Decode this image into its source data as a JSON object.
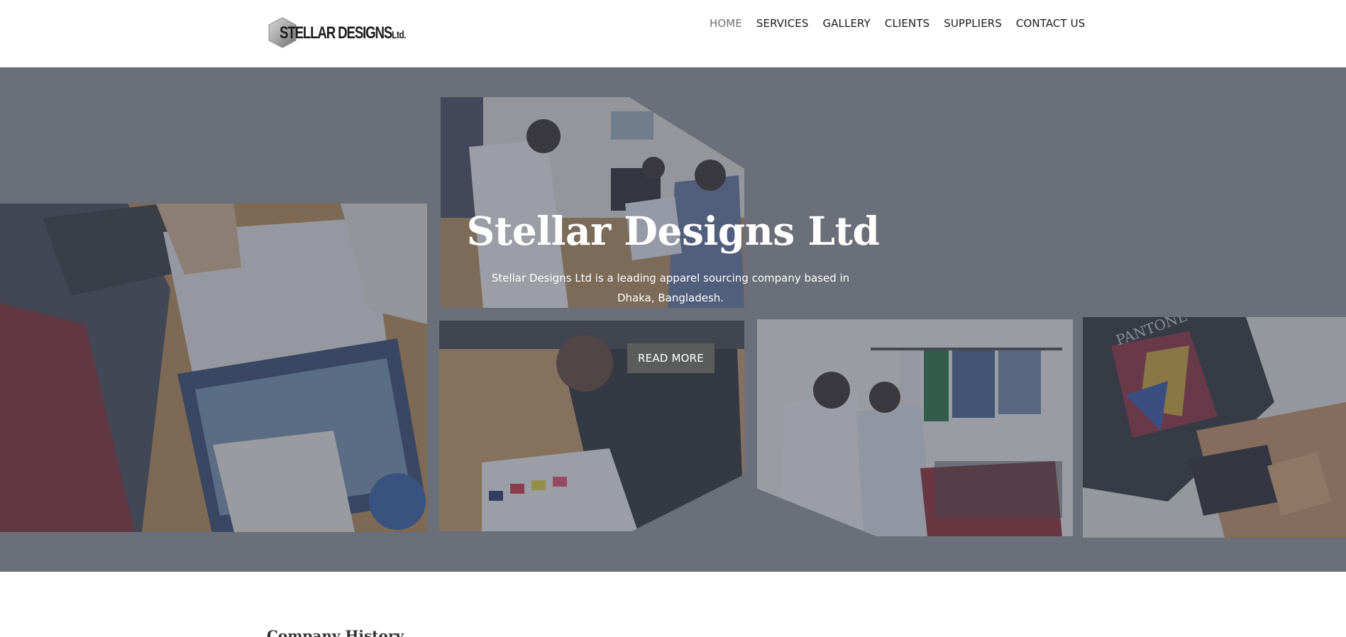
{
  "brand": {
    "name": "STELLAR DESIGNS",
    "suffix": "Ltd."
  },
  "nav": {
    "items": [
      {
        "label": "HOME",
        "active": true
      },
      {
        "label": "SERVICES",
        "active": false
      },
      {
        "label": "GALLERY",
        "active": false
      },
      {
        "label": "CLIENTS",
        "active": false
      },
      {
        "label": "SUPPLIERS",
        "active": false
      },
      {
        "label": "CONTACT US",
        "active": false
      }
    ]
  },
  "hero": {
    "title": "Stellar Designs Ltd",
    "subtitle": "Stellar Designs Ltd is a leading apparel sourcing company based in Dhaka, Bangladesh.",
    "button_label": "READ MORE",
    "overlay_color": "#484e5e"
  },
  "sections": {
    "history_title": "Company History"
  },
  "colors": {
    "nav_active": "#707070",
    "nav_text": "#1b1b1b",
    "button_bg": "#5b5c5c",
    "hero_bg": "#6b6f79"
  }
}
